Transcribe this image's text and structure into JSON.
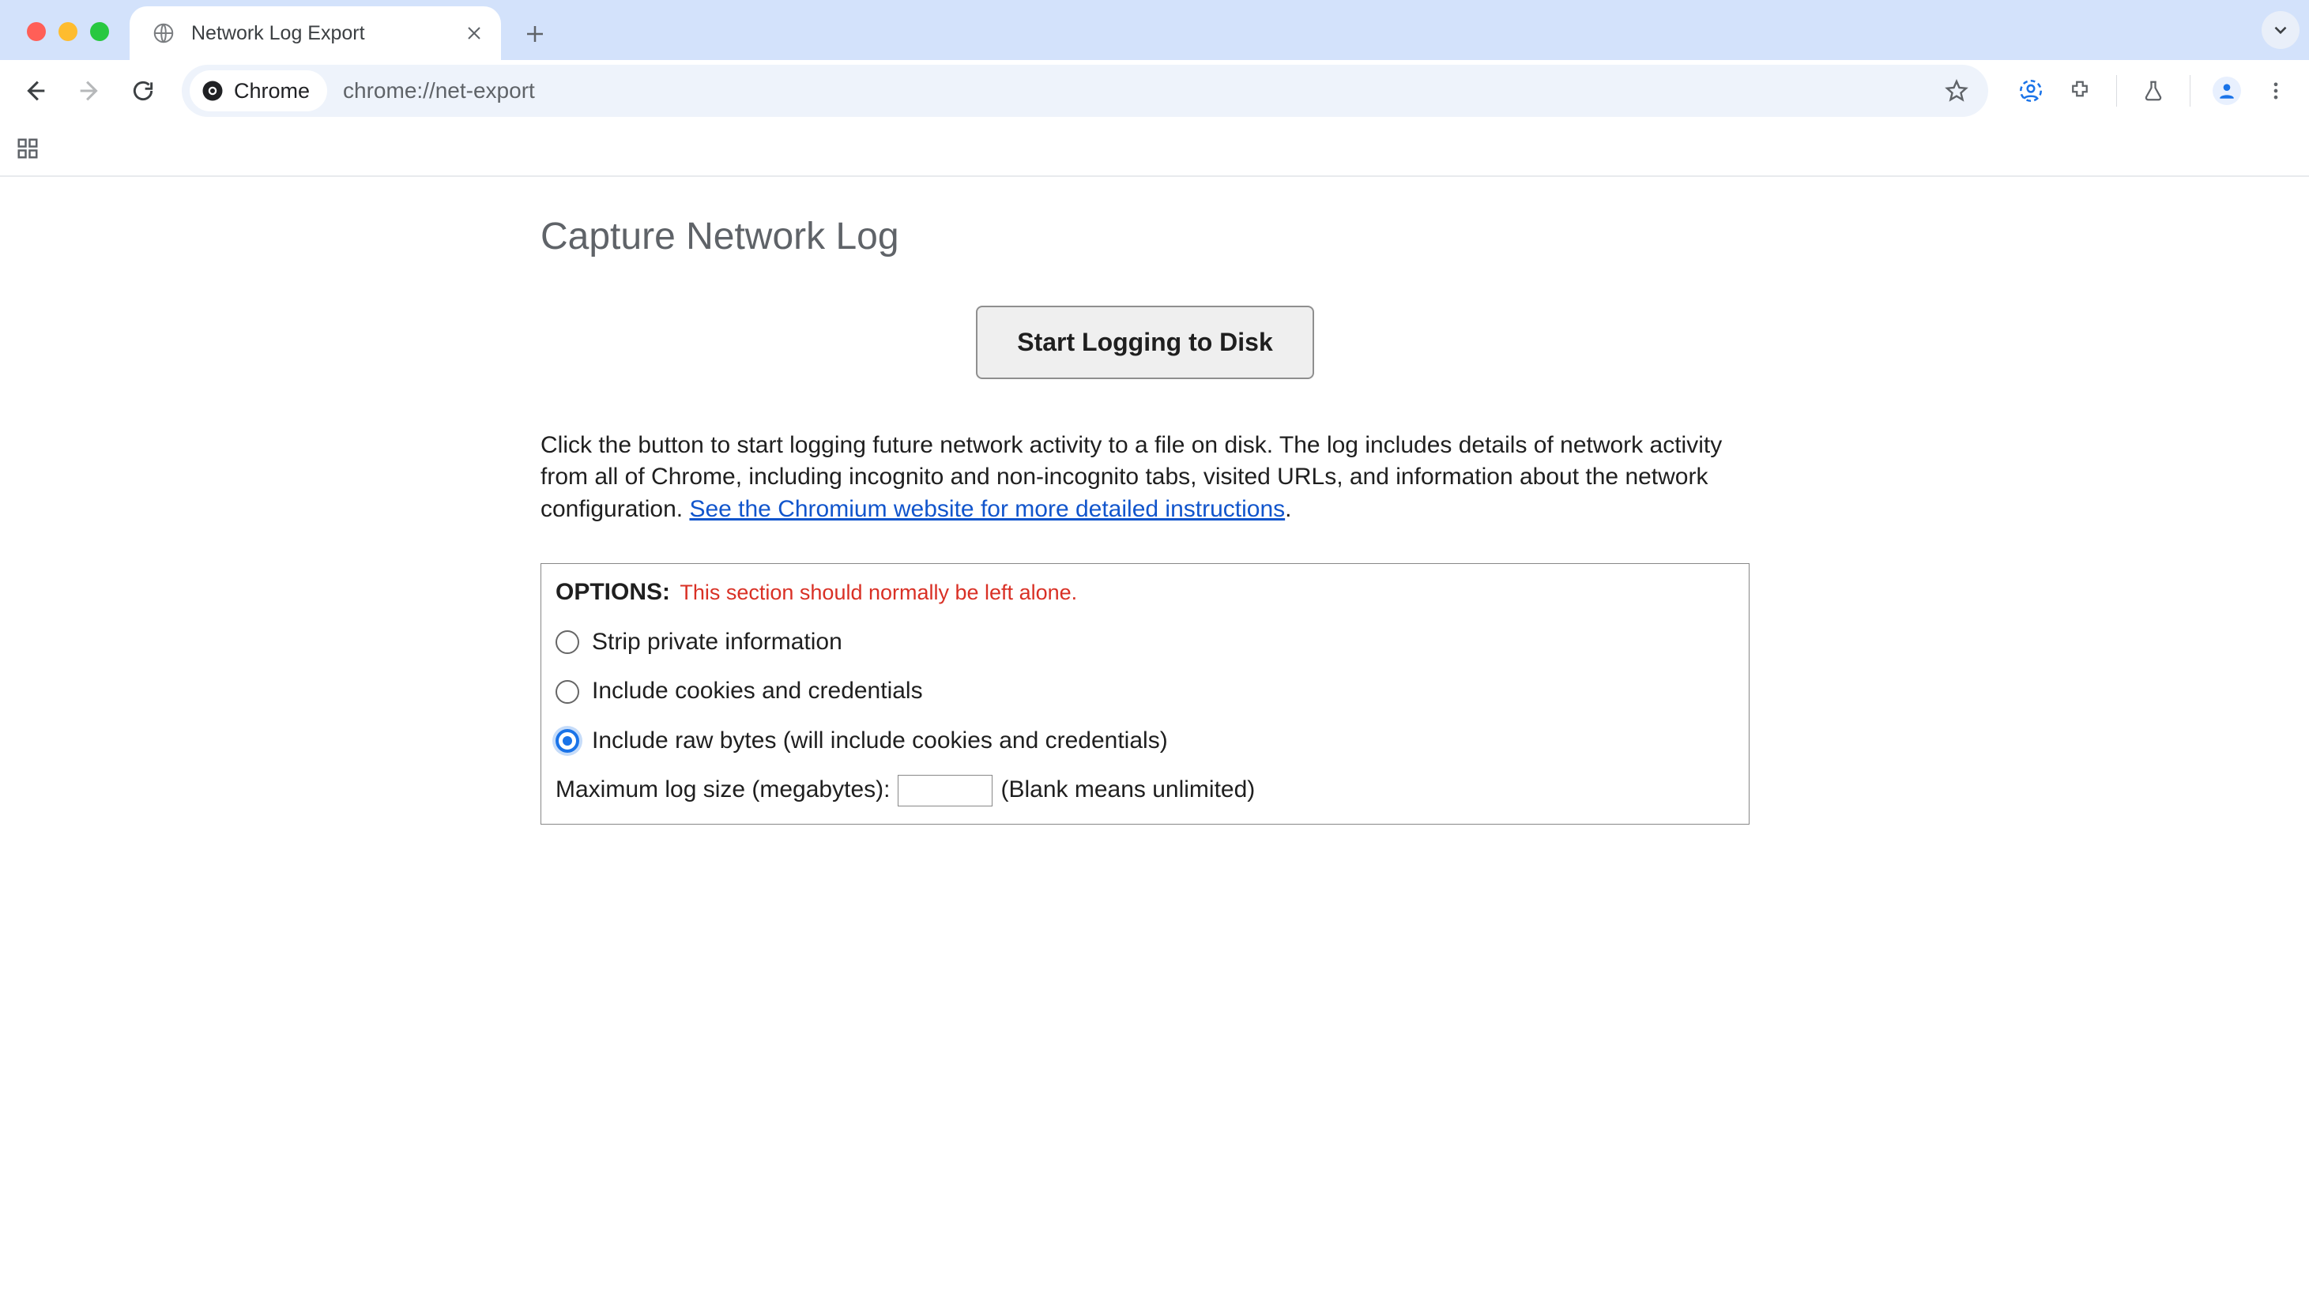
{
  "browser": {
    "tab_title": "Network Log Export",
    "addressbar": {
      "chip_label": "Chrome",
      "url": "chrome://net-export"
    }
  },
  "page": {
    "heading": "Capture Network Log",
    "start_button": "Start Logging to Disk",
    "description_prefix": "Click the button to start logging future network activity to a file on disk. The log includes details of network activity from all of Chrome, including incognito and non-incognito tabs, visited URLs, and information about the network configuration. ",
    "link_text": "See the Chromium website for more detailed instructions",
    "description_suffix": ".",
    "options": {
      "title": "OPTIONS:",
      "note": "This section should normally be left alone.",
      "radio_strip": "Strip private information",
      "radio_cookies": "Include cookies and credentials",
      "radio_raw": "Include raw bytes (will include cookies and credentials)",
      "selected": "raw",
      "size_label": "Maximum log size (megabytes):",
      "size_value": "",
      "size_hint": "(Blank means unlimited)"
    }
  }
}
